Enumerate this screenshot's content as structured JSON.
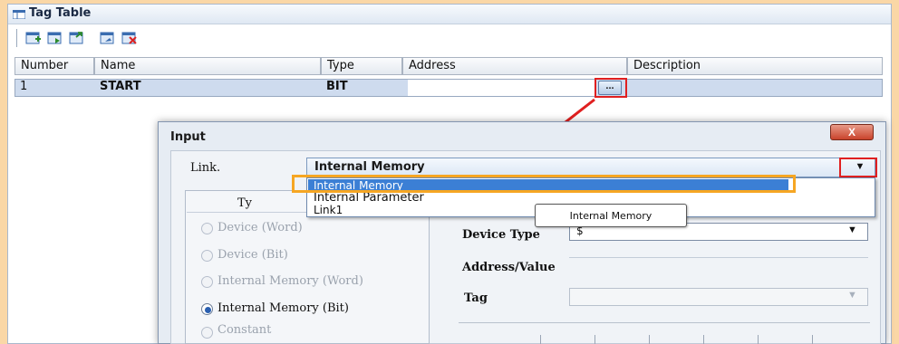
{
  "window": {
    "title": "Tag Table"
  },
  "toolbar": {
    "icons": [
      "add-row-icon",
      "insert-row-icon",
      "import-icon",
      "export-icon",
      "delete-row-icon"
    ]
  },
  "table": {
    "headers": [
      "Number",
      "Name",
      "Type",
      "Address",
      "Description"
    ],
    "row": {
      "number": "1",
      "name": "START",
      "type": "BIT",
      "address": "",
      "button_label": "...",
      "description": ""
    }
  },
  "dialog": {
    "title": "Input",
    "close_label": "X",
    "link_label": "Link.",
    "link_value": "Internal Memory",
    "dropdown_options": [
      "Internal Memory",
      "Internal Parameter",
      "Link1"
    ],
    "tooltip": "Internal Memory",
    "type_group_title": "Ty",
    "radio_options": [
      "Device (Word)",
      "Device (Bit)",
      "Internal Memory (Word)",
      "Internal Memory (Bit)",
      "Constant"
    ],
    "selected_radio": "Internal Memory (Bit)",
    "device_type_label": "Device Type",
    "device_type_value": "$",
    "address_value_label": "Address/Value",
    "tag_label": "Tag"
  },
  "colors": {
    "highlight_red": "#e02020",
    "highlight_orange": "#f6a623",
    "selection_blue": "#3b7fd5"
  }
}
